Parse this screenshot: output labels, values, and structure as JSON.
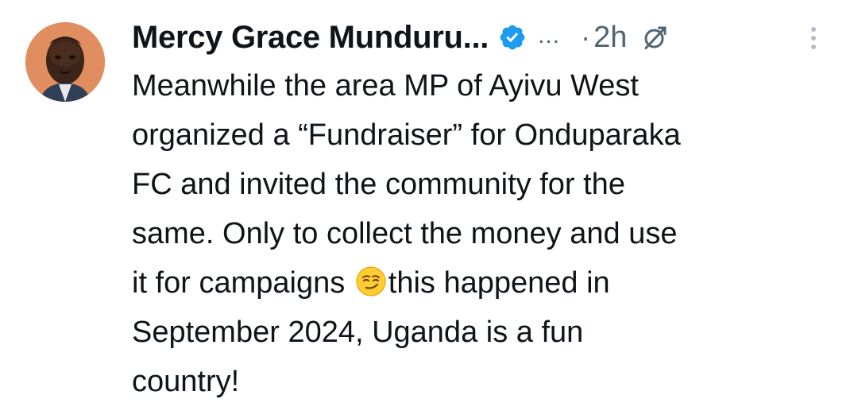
{
  "author": {
    "display_name": "Mercy Grace Munduru...",
    "handle_truncated": "...",
    "verified": true,
    "avatar_icon": "user-avatar"
  },
  "meta": {
    "separator": "·",
    "timestamp": "2h",
    "grok_icon": "grok-icon",
    "more_icon": "more-options-icon"
  },
  "tweet": {
    "lines": [
      "Meanwhile the area MP of Ayivu West",
      "organized a “Fundraiser” for Onduparaka",
      "FC and invited the community for the",
      "same. Only to collect the money and use",
      "it for campaigns ",
      "September 2024, Uganda is a fun",
      "country!"
    ],
    "line5_after_emoji": "this happened in",
    "emoji": "smirking-face-emoji"
  },
  "colors": {
    "text": "#0f1419",
    "secondary": "#536471",
    "verified": "#1d9bf0"
  }
}
